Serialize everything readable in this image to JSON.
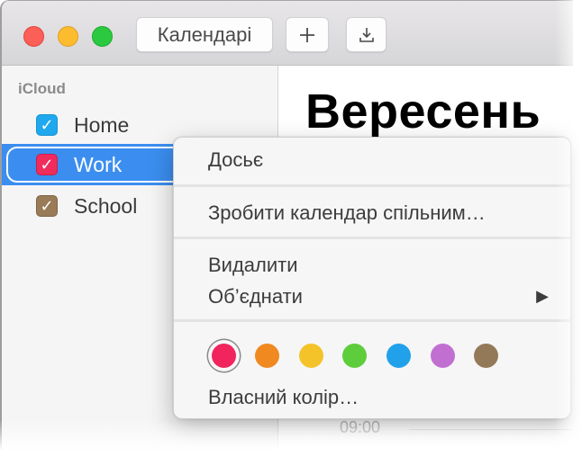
{
  "toolbar": {
    "calendars_button": "Календарі",
    "add_button": "+",
    "import_button": "⤓"
  },
  "sidebar": {
    "section_title": "iCloud",
    "calendars": [
      {
        "label": "Home",
        "color": "#1fa8ed",
        "checked": true,
        "selected": false
      },
      {
        "label": "Work",
        "color": "#f02c5d",
        "checked": true,
        "selected": true
      },
      {
        "label": "School",
        "color": "#9a7b57",
        "checked": true,
        "selected": false
      }
    ],
    "check_glyph": "✓"
  },
  "main": {
    "month_title": "Вересень",
    "time_label": "09:00"
  },
  "context_menu": {
    "get_info": "Досьє",
    "share_calendar": "Зробити календар спільним…",
    "delete": "Видалити",
    "merge": "Об’єднати",
    "merge_arrow": "▶",
    "colors": [
      {
        "name": "red",
        "hex": "#f1245d",
        "selected": true
      },
      {
        "name": "orange",
        "hex": "#f0891f",
        "selected": false
      },
      {
        "name": "yellow",
        "hex": "#f4c32a",
        "selected": false
      },
      {
        "name": "green",
        "hex": "#5dcd3c",
        "selected": false
      },
      {
        "name": "blue",
        "hex": "#21a1ea",
        "selected": false
      },
      {
        "name": "purple",
        "hex": "#c26fd2",
        "selected": false
      },
      {
        "name": "brown",
        "hex": "#947958",
        "selected": false
      }
    ],
    "custom_color": "Власний колір…"
  }
}
